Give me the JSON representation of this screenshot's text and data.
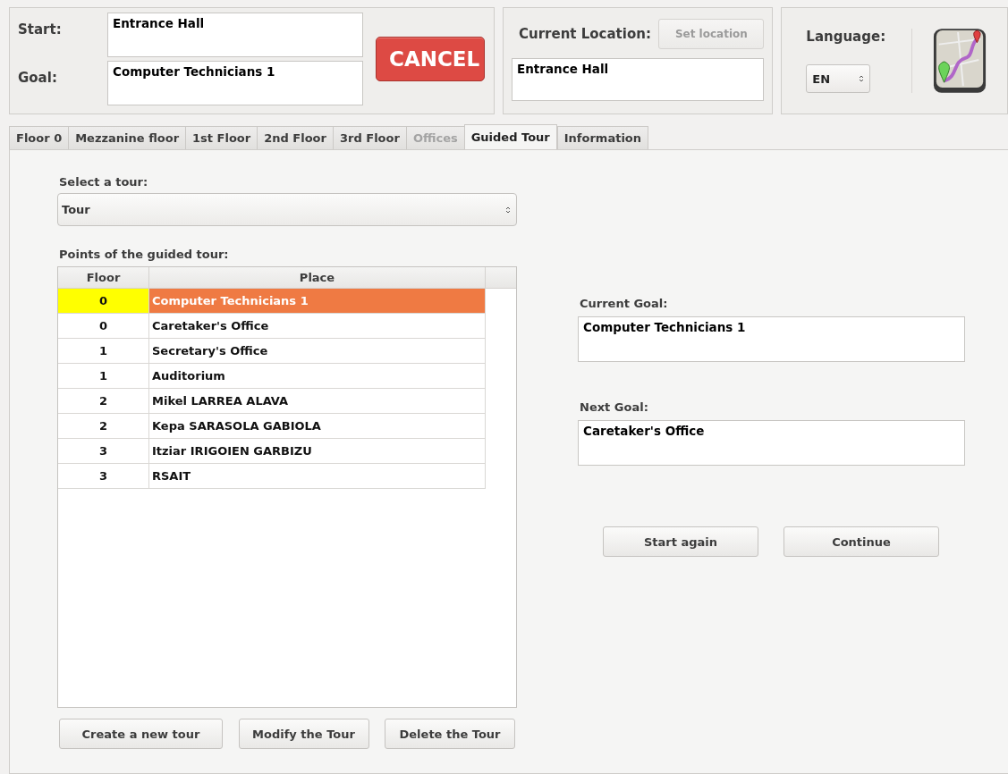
{
  "route": {
    "start_label": "Start:",
    "start_value": "Entrance Hall",
    "goal_label": "Goal:",
    "goal_value": "Computer Technicians 1",
    "cancel_button": "CANCEL"
  },
  "location": {
    "label": "Current Location:",
    "set_button": "Set location",
    "set_disabled": true,
    "value": "Entrance Hall"
  },
  "language": {
    "label": "Language:",
    "value": "EN"
  },
  "tabs": [
    {
      "label": "Floor 0",
      "selected": false,
      "disabled": false
    },
    {
      "label": "Mezzanine floor",
      "selected": false,
      "disabled": false
    },
    {
      "label": "1st Floor",
      "selected": false,
      "disabled": false
    },
    {
      "label": "2nd Floor",
      "selected": false,
      "disabled": false
    },
    {
      "label": "3rd Floor",
      "selected": false,
      "disabled": false
    },
    {
      "label": "Offices",
      "selected": false,
      "disabled": true
    },
    {
      "label": "Guided Tour",
      "selected": true,
      "disabled": false
    },
    {
      "label": "Information",
      "selected": false,
      "disabled": false
    }
  ],
  "tour_select": {
    "label": "Select a tour:",
    "value": "Tour"
  },
  "table": {
    "label": "Points of the guided tour:",
    "columns": [
      "Floor",
      "Place"
    ],
    "rows": [
      {
        "floor": "0",
        "place": "Computer Technicians 1",
        "selected": true
      },
      {
        "floor": "0",
        "place": "Caretaker's Office",
        "selected": false
      },
      {
        "floor": "1",
        "place": "Secretary's Office",
        "selected": false
      },
      {
        "floor": "1",
        "place": "Auditorium",
        "selected": false
      },
      {
        "floor": "2",
        "place": "Mikel LARREA ALAVA",
        "selected": false
      },
      {
        "floor": "2",
        "place": "Kepa SARASOLA GABIOLA",
        "selected": false
      },
      {
        "floor": "3",
        "place": "Itziar IRIGOIEN GARBIZU",
        "selected": false
      },
      {
        "floor": "3",
        "place": "RSAIT",
        "selected": false
      }
    ]
  },
  "tour_buttons": [
    "Create a new tour",
    "Modify the Tour",
    "Delete the Tour"
  ],
  "current_goal": {
    "label": "Current Goal:",
    "value": "Computer Technicians 1"
  },
  "next_goal": {
    "label": "Next Goal:",
    "value": "Caretaker's Office"
  },
  "nav_buttons": [
    "Start again",
    "Continue"
  ]
}
